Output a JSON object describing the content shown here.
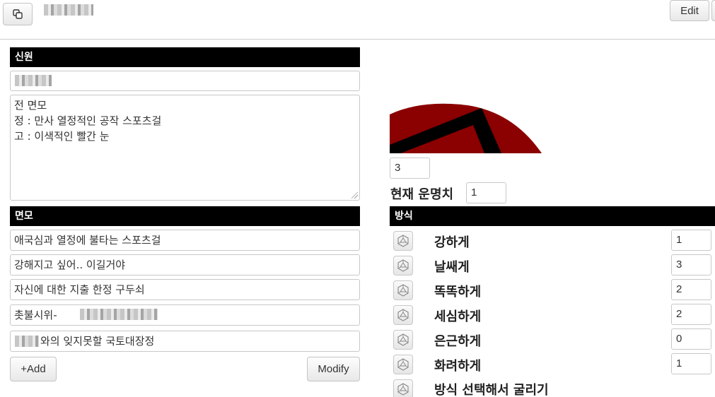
{
  "toolbar": {
    "copy_icon": "copy-icon",
    "edit_label": "Edit"
  },
  "identity": {
    "header": "신원",
    "description": "전 면모\n정 : 만사 열정적인 공작 스포츠걸\n고 : 이색적인 빨간 눈"
  },
  "aspects": {
    "header": "면모",
    "items": [
      "애국심과 열정에 불타는 스포츠걸",
      "강해지고 싶어.. 이길거야",
      "자신에 대한 지출 한정 구두쇠",
      "촛불시위-",
      "와의 잊지못할 국토대장정"
    ],
    "add_label": "+Add",
    "modify_label": "Modify"
  },
  "fate": {
    "refresh_value": "3",
    "current_label": "현재 운명치",
    "current_value": "1"
  },
  "approaches": {
    "header": "방식",
    "die_icon": "d20-die-icon",
    "items": [
      {
        "label": "강하게",
        "value": "1"
      },
      {
        "label": "날쌔게",
        "value": "3"
      },
      {
        "label": "똑똑하게",
        "value": "2"
      },
      {
        "label": "세심하게",
        "value": "2"
      },
      {
        "label": "은근하게",
        "value": "0"
      },
      {
        "label": "화려하게",
        "value": "1"
      }
    ],
    "roll_label": "방식 선택해서 굴리기"
  },
  "colors": {
    "header_bg": "#000000",
    "emblem_red": "#8b0000",
    "emblem_black": "#000000"
  }
}
